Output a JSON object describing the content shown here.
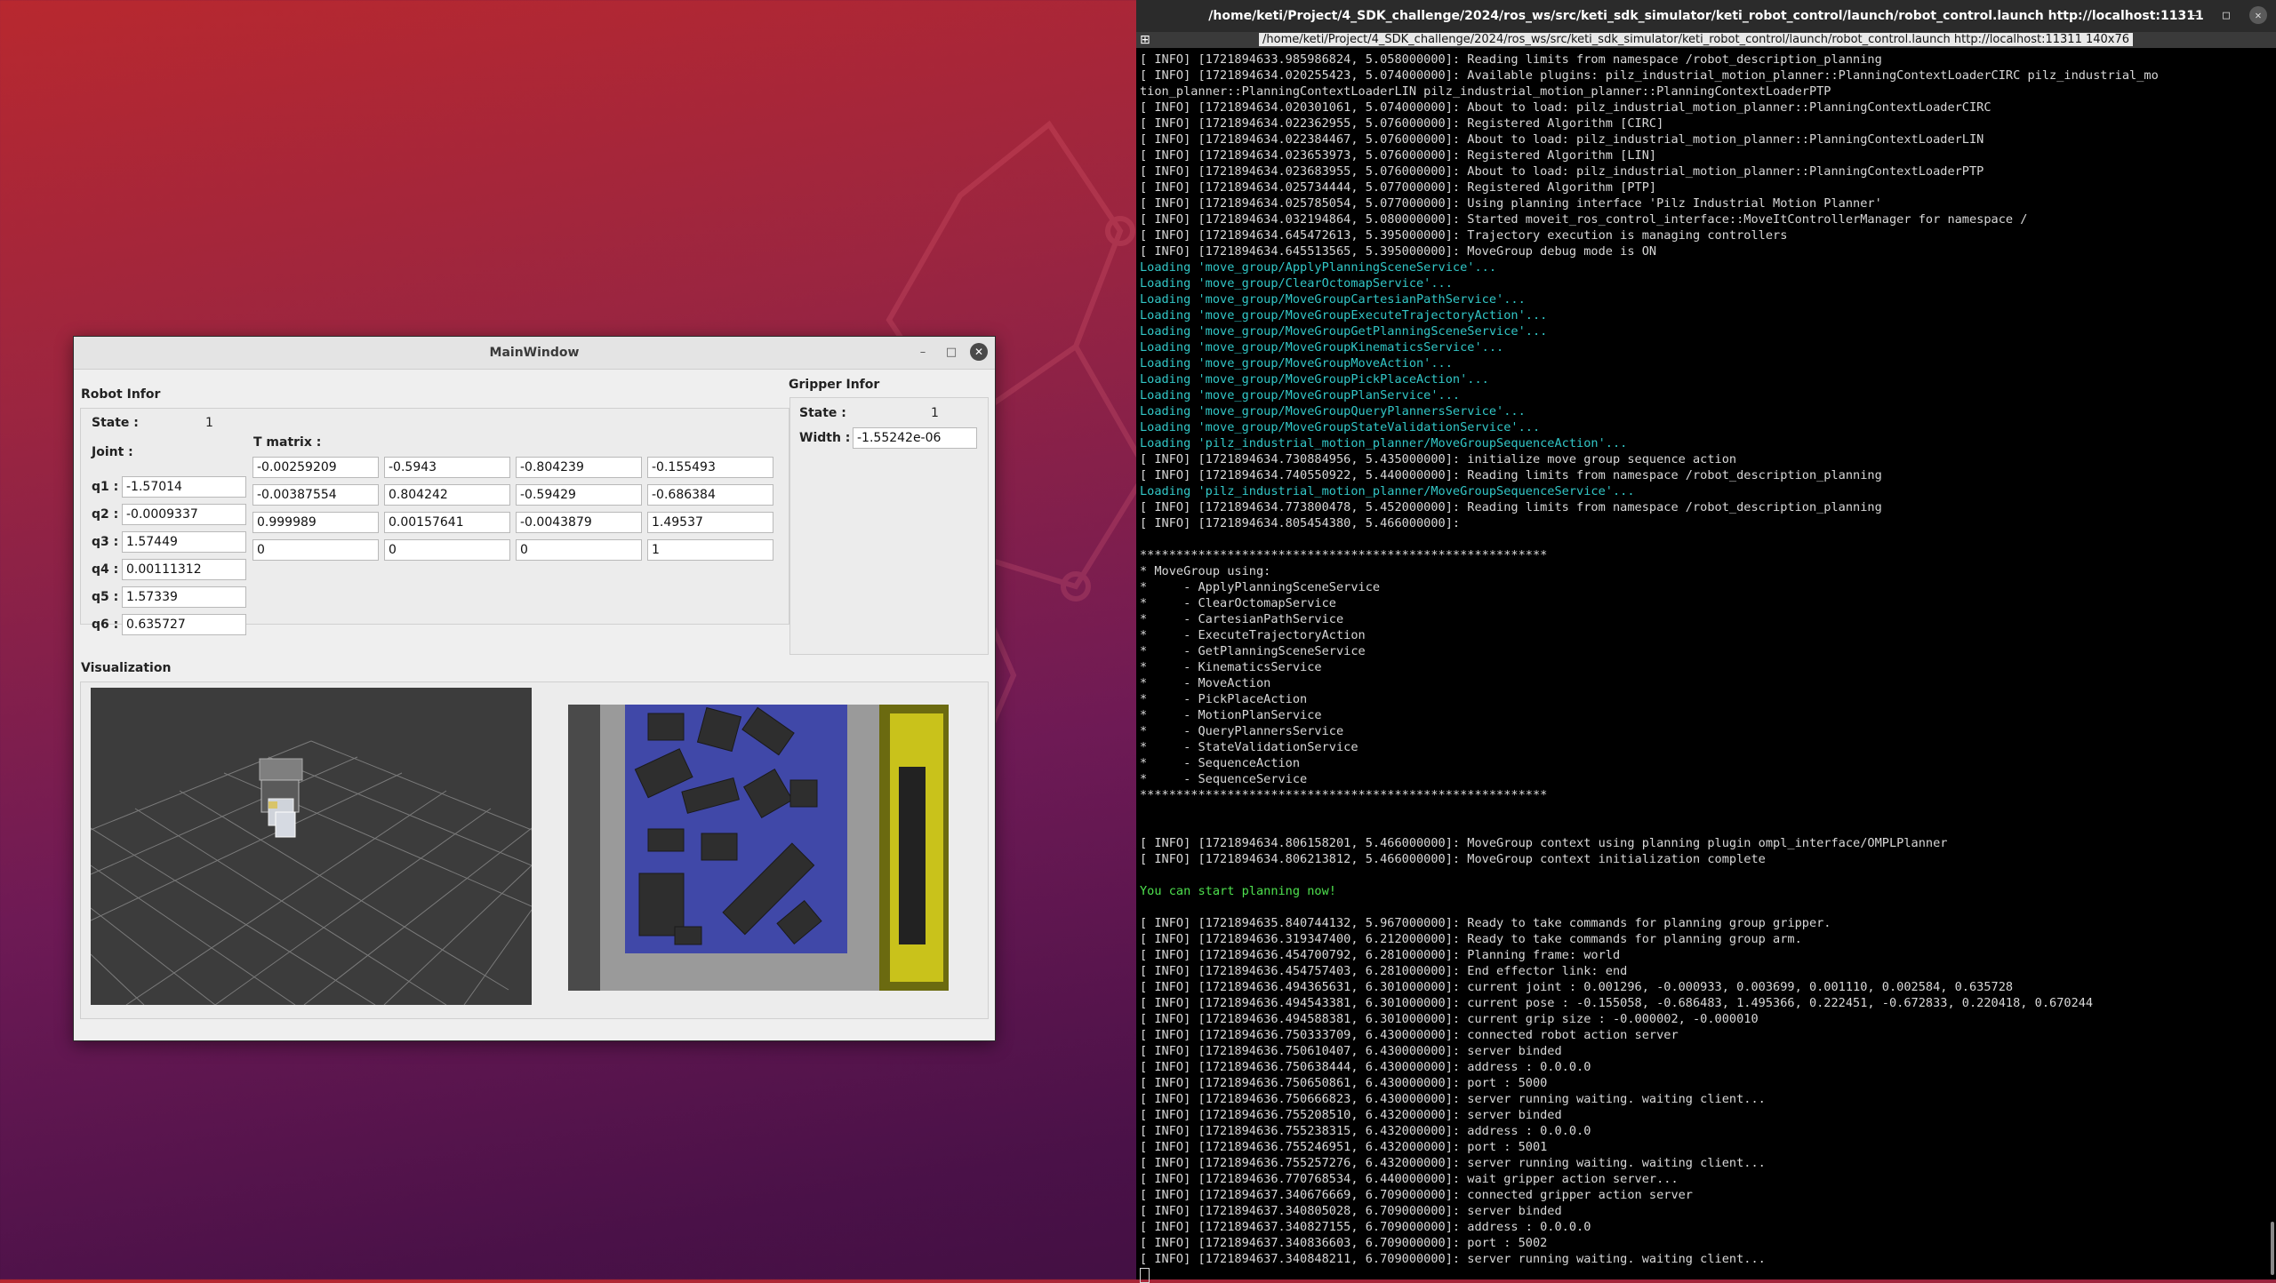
{
  "main_window": {
    "title": "MainWindow",
    "controls": {
      "minimize": "–",
      "maximize": "□",
      "close": "✕"
    },
    "robot_infor": {
      "title": "Robot Infor",
      "state_label": "State :",
      "state_value": "1",
      "joint_label": "Joint :",
      "joints": [
        {
          "label": "q1 :",
          "value": "-1.57014"
        },
        {
          "label": "q2 :",
          "value": "-0.0009337"
        },
        {
          "label": "q3 :",
          "value": "1.57449"
        },
        {
          "label": "q4 :",
          "value": "0.00111312"
        },
        {
          "label": "q5 :",
          "value": "1.57339"
        },
        {
          "label": "q6 :",
          "value": "0.635727"
        }
      ],
      "tmatrix_label": "T matrix :",
      "tmatrix": [
        [
          "-0.00259209",
          "-0.5943",
          "-0.804239",
          "-0.155493"
        ],
        [
          "-0.00387554",
          "0.804242",
          "-0.59429",
          "-0.686384"
        ],
        [
          "0.999989",
          "0.00157641",
          "-0.0043879",
          "1.49537"
        ],
        [
          "0",
          "0",
          "0",
          "1"
        ]
      ]
    },
    "gripper_infor": {
      "title": "Gripper Infor",
      "state_label": "State :",
      "state_value": "1",
      "width_label": "Width :",
      "width_value": "-1.55242e-06"
    },
    "visualization": {
      "title": "Visualization"
    }
  },
  "terminal": {
    "title": "/home/keti/Project/4_SDK_challenge/2024/ros_ws/src/keti_sdk_simulator/keti_robot_control/launch/robot_control.launch http://localhost:11311",
    "tab_title": "/home/keti/Project/4_SDK_challenge/2024/ros_ws/src/keti_sdk_simulator/keti_robot_control/launch/robot_control.launch http://localhost:11311 140x76",
    "lines": [
      {
        "text": "[ INFO] [1721894633.985986824, 5.058000000]: Reading limits from namespace /robot_description_planning",
        "color": "default"
      },
      {
        "text": "[ INFO] [1721894634.020255423, 5.074000000]: Available plugins: pilz_industrial_motion_planner::PlanningContextLoaderCIRC pilz_industrial_mo",
        "color": "default"
      },
      {
        "text": "tion_planner::PlanningContextLoaderLIN pilz_industrial_motion_planner::PlanningContextLoaderPTP",
        "color": "default"
      },
      {
        "text": "[ INFO] [1721894634.020301061, 5.074000000]: About to load: pilz_industrial_motion_planner::PlanningContextLoaderCIRC",
        "color": "default"
      },
      {
        "text": "[ INFO] [1721894634.022362955, 5.076000000]: Registered Algorithm [CIRC]",
        "color": "default"
      },
      {
        "text": "[ INFO] [1721894634.022384467, 5.076000000]: About to load: pilz_industrial_motion_planner::PlanningContextLoaderLIN",
        "color": "default"
      },
      {
        "text": "[ INFO] [1721894634.023653973, 5.076000000]: Registered Algorithm [LIN]",
        "color": "default"
      },
      {
        "text": "[ INFO] [1721894634.023683955, 5.076000000]: About to load: pilz_industrial_motion_planner::PlanningContextLoaderPTP",
        "color": "default"
      },
      {
        "text": "[ INFO] [1721894634.025734444, 5.077000000]: Registered Algorithm [PTP]",
        "color": "default"
      },
      {
        "text": "[ INFO] [1721894634.025785054, 5.077000000]: Using planning interface 'Pilz Industrial Motion Planner'",
        "color": "default"
      },
      {
        "text": "[ INFO] [1721894634.032194864, 5.080000000]: Started moveit_ros_control_interface::MoveItControllerManager for namespace /",
        "color": "default"
      },
      {
        "text": "[ INFO] [1721894634.645472613, 5.395000000]: Trajectory execution is managing controllers",
        "color": "default"
      },
      {
        "text": "[ INFO] [1721894634.645513565, 5.395000000]: MoveGroup debug mode is ON",
        "color": "default"
      },
      {
        "text": "Loading 'move_group/ApplyPlanningSceneService'...",
        "color": "cyan"
      },
      {
        "text": "Loading 'move_group/ClearOctomapService'...",
        "color": "cyan"
      },
      {
        "text": "Loading 'move_group/MoveGroupCartesianPathService'...",
        "color": "cyan"
      },
      {
        "text": "Loading 'move_group/MoveGroupExecuteTrajectoryAction'...",
        "color": "cyan"
      },
      {
        "text": "Loading 'move_group/MoveGroupGetPlanningSceneService'...",
        "color": "cyan"
      },
      {
        "text": "Loading 'move_group/MoveGroupKinematicsService'...",
        "color": "cyan"
      },
      {
        "text": "Loading 'move_group/MoveGroupMoveAction'...",
        "color": "cyan"
      },
      {
        "text": "Loading 'move_group/MoveGroupPickPlaceAction'...",
        "color": "cyan"
      },
      {
        "text": "Loading 'move_group/MoveGroupPlanService'...",
        "color": "cyan"
      },
      {
        "text": "Loading 'move_group/MoveGroupQueryPlannersService'...",
        "color": "cyan"
      },
      {
        "text": "Loading 'move_group/MoveGroupStateValidationService'...",
        "color": "cyan"
      },
      {
        "text": "Loading 'pilz_industrial_motion_planner/MoveGroupSequenceAction'...",
        "color": "cyan"
      },
      {
        "text": "[ INFO] [1721894634.730884956, 5.435000000]: initialize move group sequence action",
        "color": "default"
      },
      {
        "text": "[ INFO] [1721894634.740550922, 5.440000000]: Reading limits from namespace /robot_description_planning",
        "color": "default"
      },
      {
        "text": "Loading 'pilz_industrial_motion_planner/MoveGroupSequenceService'...",
        "color": "cyan"
      },
      {
        "text": "[ INFO] [1721894634.773800478, 5.452000000]: Reading limits from namespace /robot_description_planning",
        "color": "default"
      },
      {
        "text": "[ INFO] [1721894634.805454380, 5.466000000]:",
        "color": "default"
      },
      {
        "text": "",
        "color": "default"
      },
      {
        "text": "********************************************************",
        "color": "default"
      },
      {
        "text": "* MoveGroup using:",
        "color": "default"
      },
      {
        "text": "*     - ApplyPlanningSceneService",
        "color": "default"
      },
      {
        "text": "*     - ClearOctomapService",
        "color": "default"
      },
      {
        "text": "*     - CartesianPathService",
        "color": "default"
      },
      {
        "text": "*     - ExecuteTrajectoryAction",
        "color": "default"
      },
      {
        "text": "*     - GetPlanningSceneService",
        "color": "default"
      },
      {
        "text": "*     - KinematicsService",
        "color": "default"
      },
      {
        "text": "*     - MoveAction",
        "color": "default"
      },
      {
        "text": "*     - PickPlaceAction",
        "color": "default"
      },
      {
        "text": "*     - MotionPlanService",
        "color": "default"
      },
      {
        "text": "*     - QueryPlannersService",
        "color": "default"
      },
      {
        "text": "*     - StateValidationService",
        "color": "default"
      },
      {
        "text": "*     - SequenceAction",
        "color": "default"
      },
      {
        "text": "*     - SequenceService",
        "color": "default"
      },
      {
        "text": "********************************************************",
        "color": "default"
      },
      {
        "text": "",
        "color": "default"
      },
      {
        "text": "",
        "color": "default"
      },
      {
        "text": "[ INFO] [1721894634.806158201, 5.466000000]: MoveGroup context using planning plugin ompl_interface/OMPLPlanner",
        "color": "default"
      },
      {
        "text": "[ INFO] [1721894634.806213812, 5.466000000]: MoveGroup context initialization complete",
        "color": "default"
      },
      {
        "text": "",
        "color": "default"
      },
      {
        "text": "You can start planning now!",
        "color": "green"
      },
      {
        "text": "",
        "color": "default"
      },
      {
        "text": "[ INFO] [1721894635.840744132, 5.967000000]: Ready to take commands for planning group gripper.",
        "color": "default"
      },
      {
        "text": "[ INFO] [1721894636.319347400, 6.212000000]: Ready to take commands for planning group arm.",
        "color": "default"
      },
      {
        "text": "[ INFO] [1721894636.454700792, 6.281000000]: Planning frame: world",
        "color": "default"
      },
      {
        "text": "[ INFO] [1721894636.454757403, 6.281000000]: End effector link: end",
        "color": "default"
      },
      {
        "text": "[ INFO] [1721894636.494365631, 6.301000000]: current joint : 0.001296, -0.000933, 0.003699, 0.001110, 0.002584, 0.635728",
        "color": "default"
      },
      {
        "text": "[ INFO] [1721894636.494543381, 6.301000000]: current pose : -0.155058, -0.686483, 1.495366, 0.222451, -0.672833, 0.220418, 0.670244",
        "color": "default"
      },
      {
        "text": "[ INFO] [1721894636.494588381, 6.301000000]: current grip size : -0.000002, -0.000010",
        "color": "default"
      },
      {
        "text": "[ INFO] [1721894636.750333709, 6.430000000]: connected robot action server",
        "color": "default"
      },
      {
        "text": "[ INFO] [1721894636.750610407, 6.430000000]: server binded",
        "color": "default"
      },
      {
        "text": "[ INFO] [1721894636.750638444, 6.430000000]: address : 0.0.0.0",
        "color": "default"
      },
      {
        "text": "[ INFO] [1721894636.750650861, 6.430000000]: port : 5000",
        "color": "default"
      },
      {
        "text": "[ INFO] [1721894636.750666823, 6.430000000]: server running waiting. waiting client...",
        "color": "default"
      },
      {
        "text": "[ INFO] [1721894636.755208510, 6.432000000]: server binded",
        "color": "default"
      },
      {
        "text": "[ INFO] [1721894636.755238315, 6.432000000]: address : 0.0.0.0",
        "color": "default"
      },
      {
        "text": "[ INFO] [1721894636.755246951, 6.432000000]: port : 5001",
        "color": "default"
      },
      {
        "text": "[ INFO] [1721894636.755257276, 6.432000000]: server running waiting. waiting client...",
        "color": "default"
      },
      {
        "text": "[ INFO] [1721894636.770768534, 6.440000000]: wait gripper action server...",
        "color": "default"
      },
      {
        "text": "[ INFO] [1721894637.340676669, 6.709000000]: connected gripper action server",
        "color": "default"
      },
      {
        "text": "[ INFO] [1721894637.340805028, 6.709000000]: server binded",
        "color": "default"
      },
      {
        "text": "[ INFO] [1721894637.340827155, 6.709000000]: address : 0.0.0.0",
        "color": "default"
      },
      {
        "text": "[ INFO] [1721894637.340836603, 6.709000000]: port : 5002",
        "color": "default"
      },
      {
        "text": "[ INFO] [1721894637.340848211, 6.709000000]: server running waiting. waiting client...",
        "color": "default"
      }
    ]
  }
}
